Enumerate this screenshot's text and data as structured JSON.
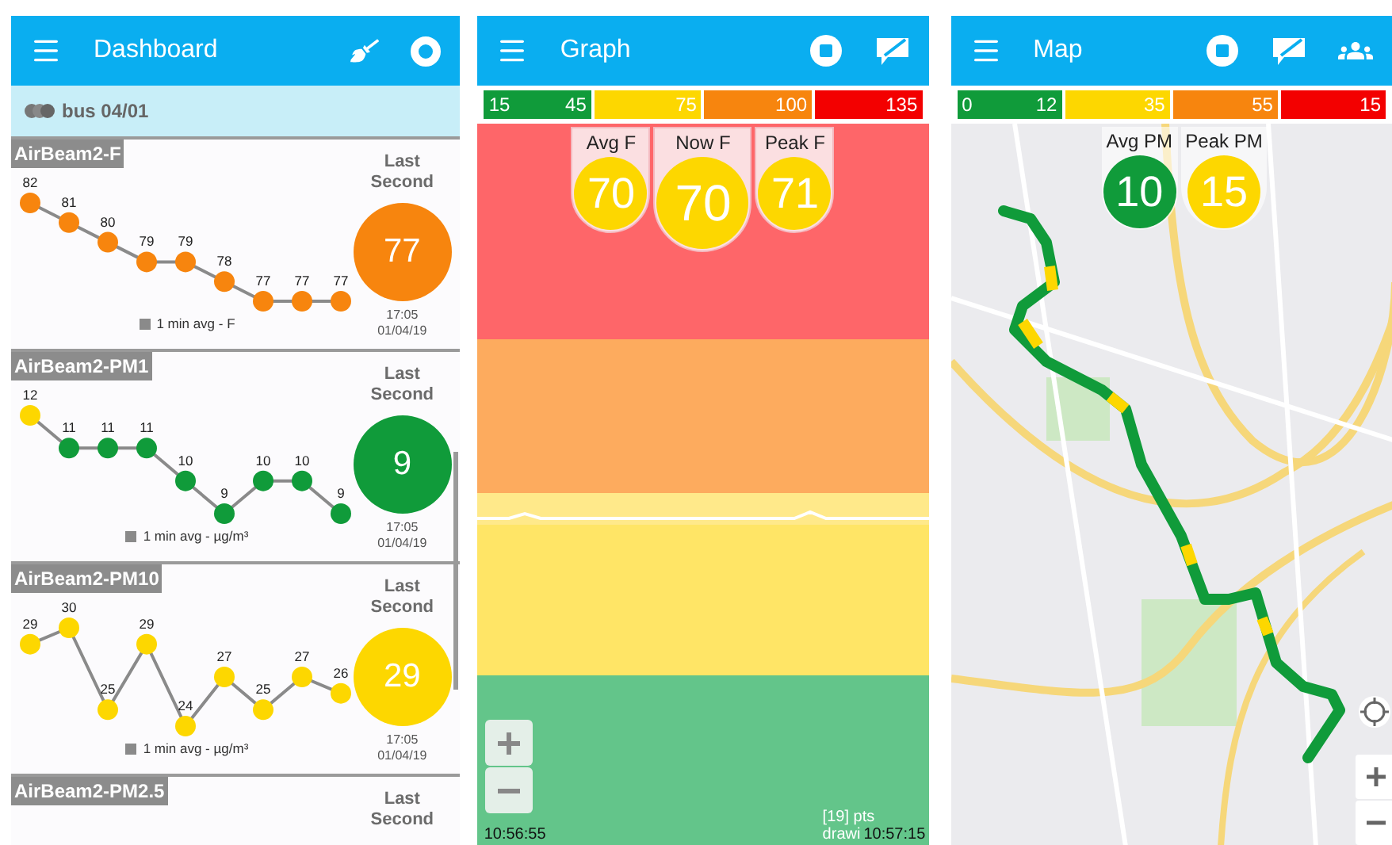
{
  "dashboard": {
    "title": "Dashboard",
    "session": "bus 04/01",
    "cards": [
      {
        "name": "AirBeam2-F",
        "chart_data": {
          "type": "line",
          "series": [
            {
              "name": "1 min avg - F",
              "color": "#8a8a8a",
              "marker": "circle",
              "values": [
                82,
                81,
                80,
                79,
                79,
                78,
                77,
                77,
                77
              ]
            }
          ],
          "data_labels": true
        },
        "markers": [
          {
            "color": "#f7850e"
          },
          {
            "color": "#f7850e"
          },
          {
            "color": "#f7850e"
          },
          {
            "color": "#f7850e"
          },
          {
            "color": "#f7850e"
          },
          {
            "color": "#f7850e"
          },
          {
            "color": "#f7850e"
          },
          {
            "color": "#f7850e"
          },
          {
            "color": "#f7850e"
          }
        ],
        "last_label": "Last Second",
        "reading": {
          "value": "77",
          "color": "#f7850e"
        },
        "time": "17:05",
        "date": "01/04/19"
      },
      {
        "name": "AirBeam2-PM1",
        "chart_data": {
          "type": "line",
          "series": [
            {
              "name": "1 min avg - µg/m³",
              "color": "#8a8a8a",
              "marker": "circle",
              "values": [
                12,
                11,
                11,
                11,
                10,
                9,
                10,
                10,
                9
              ]
            }
          ],
          "data_labels": true
        },
        "markers": [
          {
            "color": "#fdd700"
          },
          {
            "color": "#109b3a"
          },
          {
            "color": "#109b3a"
          },
          {
            "color": "#109b3a"
          },
          {
            "color": "#109b3a"
          },
          {
            "color": "#109b3a"
          },
          {
            "color": "#109b3a"
          },
          {
            "color": "#109b3a"
          },
          {
            "color": "#109b3a"
          }
        ],
        "last_label": "Last Second",
        "reading": {
          "value": "9",
          "color": "#109b3a"
        },
        "time": "17:05",
        "date": "01/04/19"
      },
      {
        "name": "AirBeam2-PM10",
        "chart_data": {
          "type": "line",
          "series": [
            {
              "name": "1 min avg - µg/m³",
              "color": "#8a8a8a",
              "marker": "circle",
              "values": [
                29,
                30,
                25,
                29,
                24,
                27,
                25,
                27,
                26
              ]
            }
          ],
          "data_labels": true
        },
        "markers": [
          {
            "color": "#fdd700"
          },
          {
            "color": "#fdd700"
          },
          {
            "color": "#fdd700"
          },
          {
            "color": "#fdd700"
          },
          {
            "color": "#fdd700"
          },
          {
            "color": "#fdd700"
          },
          {
            "color": "#fdd700"
          },
          {
            "color": "#fdd700"
          },
          {
            "color": "#fdd700"
          }
        ],
        "last_label": "Last Second",
        "reading": {
          "value": "29",
          "color": "#fdd700"
        },
        "time": "17:05",
        "date": "01/04/19"
      },
      {
        "name": "AirBeam2-PM2.5",
        "last_label": "Last Second"
      }
    ]
  },
  "graph": {
    "title": "Graph",
    "thresholds": {
      "min": "15",
      "segments": [
        {
          "label": "45",
          "color": "#109b3a"
        },
        {
          "label": "75",
          "color": "#fdd700"
        },
        {
          "label": "100",
          "color": "#f7850e"
        },
        {
          "label": "135",
          "color": "#f30000"
        }
      ]
    },
    "badges": [
      {
        "label": "Avg F",
        "value": "70",
        "color": "#fdd700",
        "kind": "stat"
      },
      {
        "label": "Now F",
        "value": "70",
        "color": "#fdd700",
        "kind": "current"
      },
      {
        "label": "Peak F",
        "value": "71",
        "color": "#fdd700",
        "kind": "stat"
      }
    ],
    "time_start": "10:56:55",
    "points": "[19] pts",
    "drawing_note": "drawi",
    "time_end": "10:57:15"
  },
  "map": {
    "title": "Map",
    "thresholds": {
      "min": "0",
      "segments": [
        {
          "label": "12",
          "color": "#109b3a"
        },
        {
          "label": "35",
          "color": "#fdd700"
        },
        {
          "label": "55",
          "color": "#f7850e"
        },
        {
          "label": "15",
          "color": "#f30000"
        }
      ]
    },
    "badges": [
      {
        "label": "Avg PM",
        "value": "10",
        "color": "#109b3a"
      },
      {
        "label": "Peak PM",
        "value": "15",
        "color": "#fdd700"
      }
    ]
  }
}
